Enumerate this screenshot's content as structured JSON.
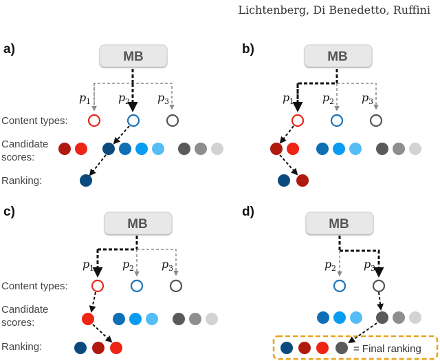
{
  "header": {
    "authors": "Lichtenberg, Di Benedetto, Ruffini"
  },
  "labels": {
    "mb": "MB",
    "content_types": "Content types:",
    "candidate_line1": "Candidate",
    "candidate_line2": "scores:",
    "ranking": "Ranking:",
    "final_ranking": "= Final ranking",
    "p": "p",
    "p1_sub": "1",
    "p2_sub": "2",
    "p3_sub": "3"
  },
  "colors": {
    "red_type": "#e8291c",
    "blue_type": "#1a73b8",
    "gray_type": "#555555",
    "red_scores": [
      "#b01a0e",
      "#ee2415"
    ],
    "blue_scores": [
      "#0b4a7e",
      "#0f6fb5",
      "#0a9cf0",
      "#55bdf5"
    ],
    "gray_scores": [
      "#5a5a5a",
      "#8e8e8e",
      "#d3d3d3"
    ],
    "final_box": "#e8a21a",
    "mb_fill": "#e8e8e8"
  },
  "panels": [
    {
      "id": "a",
      "label": "a)",
      "selected_type": "p2",
      "ranking": [
        "dark-blue"
      ]
    },
    {
      "id": "b",
      "label": "b)",
      "selected_type": "p1",
      "ranking": [
        "dark-blue",
        "dark-red"
      ]
    },
    {
      "id": "c",
      "label": "c)",
      "selected_type": "p1",
      "ranking": [
        "dark-blue",
        "dark-red",
        "red"
      ]
    },
    {
      "id": "d",
      "label": "d)",
      "selected_type": "p3",
      "ranking": [
        "dark-blue",
        "dark-red",
        "red",
        "dark-gray"
      ]
    }
  ]
}
